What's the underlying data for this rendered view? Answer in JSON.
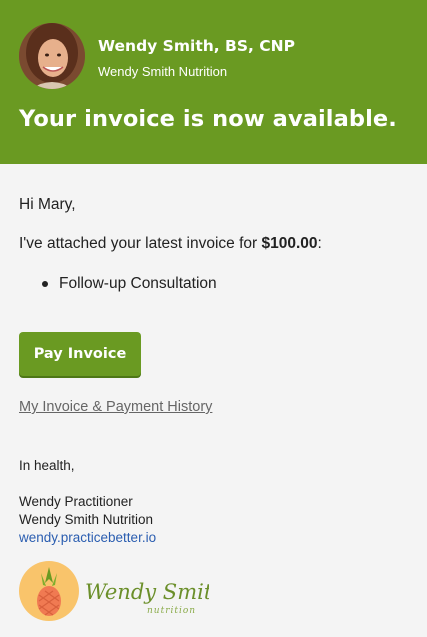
{
  "header": {
    "sender_name": "Wendy Smith, BS, CNP",
    "sender_org": "Wendy Smith Nutrition",
    "headline": "Your invoice is now available."
  },
  "body": {
    "greeting": "Hi Mary,",
    "intro_prefix": "I've attached your latest invoice for ",
    "amount": "$100.00",
    "intro_suffix": ":",
    "items": [
      "Follow-up Consultation"
    ]
  },
  "actions": {
    "pay_label": "Pay Invoice",
    "history_label": "My Invoice & Payment History"
  },
  "signature": {
    "signoff": "In health,",
    "name": "Wendy Practitioner",
    "org": "Wendy Smith Nutrition",
    "url": "wendy.practicebetter.io"
  },
  "logo": {
    "script_text": "Wendy Smith",
    "sub_text": "nutrition"
  },
  "colors": {
    "brand_green": "#6a9a22",
    "link_blue": "#2a5db0"
  }
}
